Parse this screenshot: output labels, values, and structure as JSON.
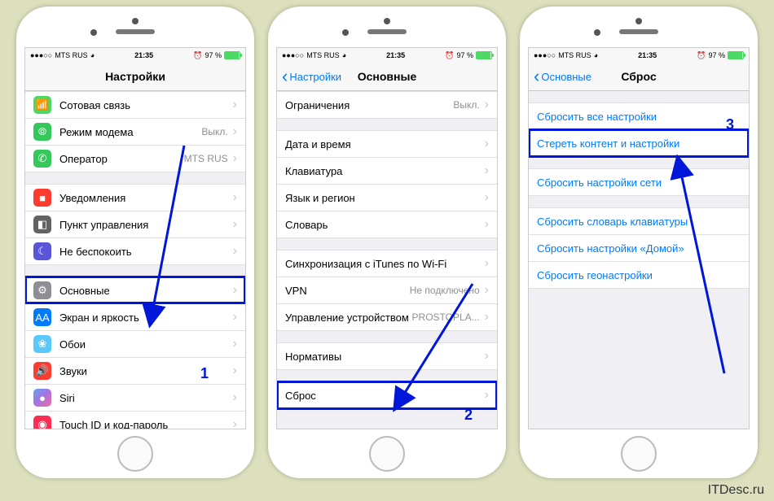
{
  "statusbar": {
    "carrier": "MTS RUS",
    "time": "21:35",
    "battery": "97 %"
  },
  "phone1": {
    "title": "Настройки",
    "rows": {
      "cellular": "Сотовая связь",
      "hotspot": "Режим модема",
      "hotspot_value": "Выкл.",
      "carrier": "Оператор",
      "carrier_value": "MTS RUS",
      "notifications": "Уведомления",
      "control_center": "Пункт управления",
      "dnd": "Не беспокоить",
      "general": "Основные",
      "display": "Экран и яркость",
      "wallpaper": "Обои",
      "sounds": "Звуки",
      "siri": "Siri",
      "touchid": "Touch ID и код-пароль"
    },
    "step": "1"
  },
  "phone2": {
    "back": "Настройки",
    "title": "Основные",
    "rows": {
      "restrictions": "Ограничения",
      "restrictions_value": "Выкл.",
      "date_time": "Дата и время",
      "keyboard": "Клавиатура",
      "language": "Язык и регион",
      "dictionary": "Словарь",
      "itunes_wifi": "Синхронизация с iTunes по Wi-Fi",
      "vpn": "VPN",
      "vpn_value": "Не подключено",
      "device_mgmt": "Управление устройством",
      "device_mgmt_value": "PROSTOPLA...",
      "regulatory": "Нормативы",
      "reset": "Сброс"
    },
    "step": "2"
  },
  "phone3": {
    "back": "Основные",
    "title": "Сброс",
    "rows": {
      "reset_all": "Сбросить все настройки",
      "erase_all": "Стереть контент и настройки",
      "reset_network": "Сбросить настройки сети",
      "reset_keyboard": "Сбросить словарь клавиатуры",
      "reset_home": "Сбросить настройки «Домой»",
      "reset_location": "Сбросить геонастройки"
    },
    "step": "3"
  },
  "watermark": "ITDesc.ru"
}
